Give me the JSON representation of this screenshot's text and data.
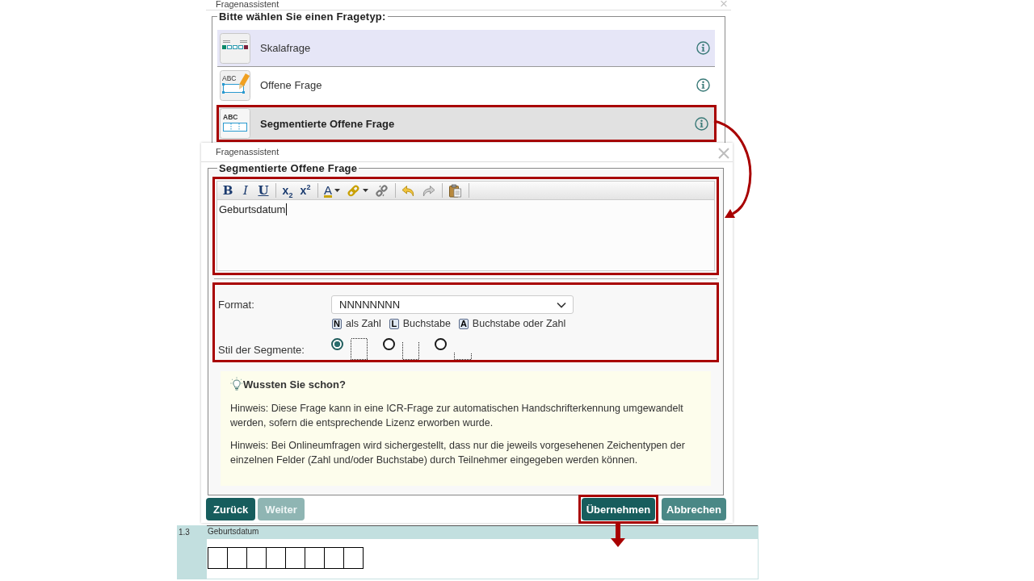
{
  "type_dialog": {
    "title": "Fragenassistent",
    "legend": "Bitte wählen Sie einen Fragetyp:",
    "question_types": [
      {
        "kind": "scale",
        "label": "Skalafrage",
        "selected": false,
        "hovered": true,
        "highlighted": false
      },
      {
        "kind": "open",
        "icon_text": "ABC",
        "label": "Offene Frage",
        "selected": false,
        "hovered": false,
        "highlighted": false
      },
      {
        "kind": "segmented",
        "icon_text": "ABC",
        "label": "Segmentierte Offene Frage",
        "selected": true,
        "hovered": false,
        "highlighted": true
      }
    ]
  },
  "editor_dialog": {
    "title": "Fragenassistent",
    "legend": "Segmentierte Offene Frage",
    "editor": {
      "highlighted": true,
      "toolbar_groups": [
        {
          "buttons": [
            {
              "kind": "bold",
              "label": "B"
            },
            {
              "kind": "italic",
              "label": "I"
            },
            {
              "kind": "underline",
              "label": "U"
            }
          ]
        },
        {
          "buttons": [
            {
              "kind": "subscript",
              "label": "x$_{2}$"
            },
            {
              "kind": "superscript",
              "label": "x$^{2}$"
            }
          ]
        },
        {
          "buttons": [
            {
              "kind": "font_color",
              "label": "A"
            },
            {
              "kind": "link"
            },
            {
              "kind": "unlink"
            }
          ]
        },
        {
          "buttons": [
            {
              "kind": "undo"
            },
            {
              "kind": "redo"
            }
          ]
        },
        {
          "buttons": [
            {
              "kind": "paste"
            }
          ]
        }
      ],
      "value": "Geburtsdatum"
    },
    "segment_format": {
      "highlighted": true,
      "format_label": "Format:",
      "format_value": "NNNNNNNN",
      "key_legend": [
        {
          "key": "N",
          "text": "als Zahl"
        },
        {
          "key": "L",
          "text": "Buchstabe"
        },
        {
          "key": "A",
          "text": "Buchstabe oder Zahl"
        }
      ],
      "style_label": "Stil der Segmente:",
      "style_options": [
        {
          "kind": "box",
          "selected": true
        },
        {
          "kind": "open_top",
          "selected": false
        },
        {
          "kind": "baseline",
          "selected": false
        }
      ]
    },
    "tip": {
      "title": "Wussten Sie schon?",
      "paragraphs": [
        "Hinweis: Diese Frage kann in eine ICR-Frage zur automatischen Handschrifterkennung umgewandelt werden, sofern die entsprechende Lizenz erworben wurde.",
        "Hinweis: Bei Onlineumfragen wird sichergestellt, dass nur die jeweils vorgesehenen Zeichentypen der einzelnen Felder (Zahl und/oder Buchstabe) durch Teilnehmer eingegeben werden können."
      ]
    },
    "nav_buttons": [
      {
        "label": "Zurück",
        "disabled": false
      },
      {
        "label": "Weiter",
        "disabled": true
      }
    ],
    "action_buttons": [
      {
        "kind": "primary",
        "label": "Übernehmen",
        "highlighted": true
      },
      {
        "kind": "secondary",
        "label": "Abbrechen",
        "highlighted": false
      }
    ]
  },
  "preview": {
    "number": "1.3",
    "question": "Geburtsdatum",
    "segments": [
      {
        "kind": "box"
      },
      {
        "kind": "box"
      },
      {
        "kind": "box"
      },
      {
        "kind": "box"
      },
      {
        "kind": "box"
      },
      {
        "kind": "box"
      },
      {
        "kind": "box"
      },
      {
        "kind": "box"
      }
    ]
  },
  "arrows": {
    "type_to_editor": true,
    "apply_to_preview": true
  }
}
